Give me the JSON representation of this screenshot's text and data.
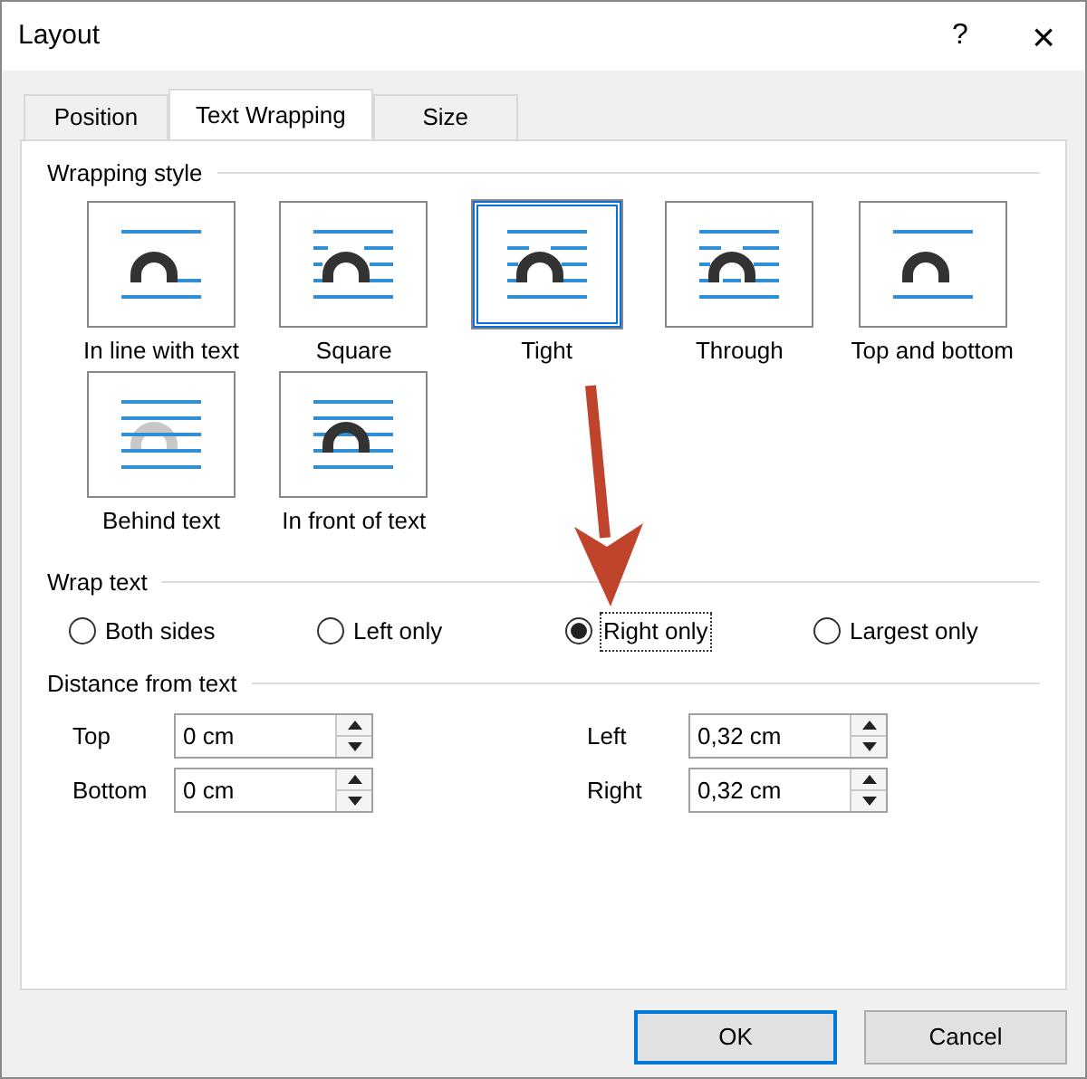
{
  "window": {
    "title": "Layout"
  },
  "title_buttons": [
    "?",
    "×"
  ],
  "tabs": [
    {
      "label": "Position",
      "selected": false
    },
    {
      "label": "Text Wrapping",
      "selected": true
    },
    {
      "label": "Size",
      "selected": false
    }
  ],
  "wrapping_style": {
    "heading": "Wrapping style",
    "options": [
      {
        "label": "In line with text",
        "kind": "inline",
        "selected": false
      },
      {
        "label": "Square",
        "kind": "square",
        "selected": false
      },
      {
        "label": "Tight",
        "kind": "tight",
        "selected": true
      },
      {
        "label": "Through",
        "kind": "through",
        "selected": false
      },
      {
        "label": "Top and bottom",
        "kind": "topbottom",
        "selected": false
      },
      {
        "label": "Behind text",
        "kind": "behind",
        "selected": false
      },
      {
        "label": "In front of text",
        "kind": "front",
        "selected": false
      }
    ]
  },
  "wrap_text": {
    "heading": "Wrap text",
    "options": [
      {
        "label": "Both sides",
        "selected": false
      },
      {
        "label": "Left only",
        "selected": false
      },
      {
        "label": "Right only",
        "selected": true
      },
      {
        "label": "Largest only",
        "selected": false
      }
    ]
  },
  "distance": {
    "heading": "Distance from text",
    "fields": [
      {
        "label": "Top",
        "value": "0 cm"
      },
      {
        "label": "Left",
        "value": "0,32 cm"
      },
      {
        "label": "Bottom",
        "value": "0 cm"
      },
      {
        "label": "Right",
        "value": "0,32 cm"
      }
    ]
  },
  "buttons": [
    {
      "label": "OK",
      "default": true
    },
    {
      "label": "Cancel",
      "default": false
    }
  ]
}
